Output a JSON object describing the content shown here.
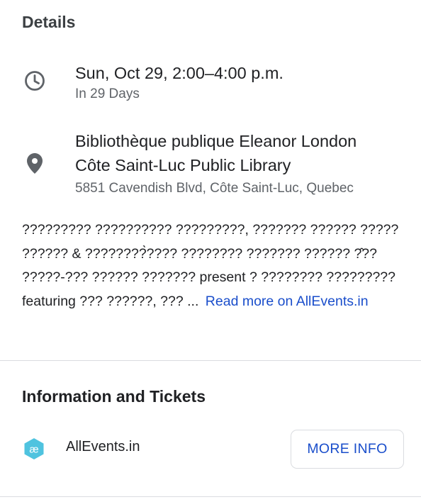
{
  "details": {
    "title": "Details",
    "datetime": {
      "icon": "clock-icon",
      "primary": "Sun, Oct 29, 2:00–4:00 p.m.",
      "secondary": "In 29 Days"
    },
    "location": {
      "icon": "location-pin-icon",
      "name_line1": "Bibliothèque publique Eleanor London",
      "name_line2": "Côte Saint-Luc Public Library",
      "address": "5851 Cavendish Blvd, Côte Saint-Luc, Quebec"
    },
    "description": {
      "text": "????????? ?????????? ?????????, ??????? ?????? ????? ?????? & ????????̀???? ???????? ??????? ?????? ?̂?? ?????-??? ?????? ??????? present ? ???????? ????????? featuring ??? ??????, ??? ...",
      "read_more_label": "Read more on AllEvents.in"
    }
  },
  "info": {
    "title": "Information and Tickets",
    "provider": {
      "icon": "allevents-logo-icon",
      "logo_text": "æ",
      "name": "AllEvents.in",
      "button_label": "MORE INFO"
    }
  },
  "colors": {
    "link": "#1a4ecb",
    "icon_gray": "#5f6368",
    "logo_teal": "#4fc3df",
    "divider": "#dadce0"
  }
}
